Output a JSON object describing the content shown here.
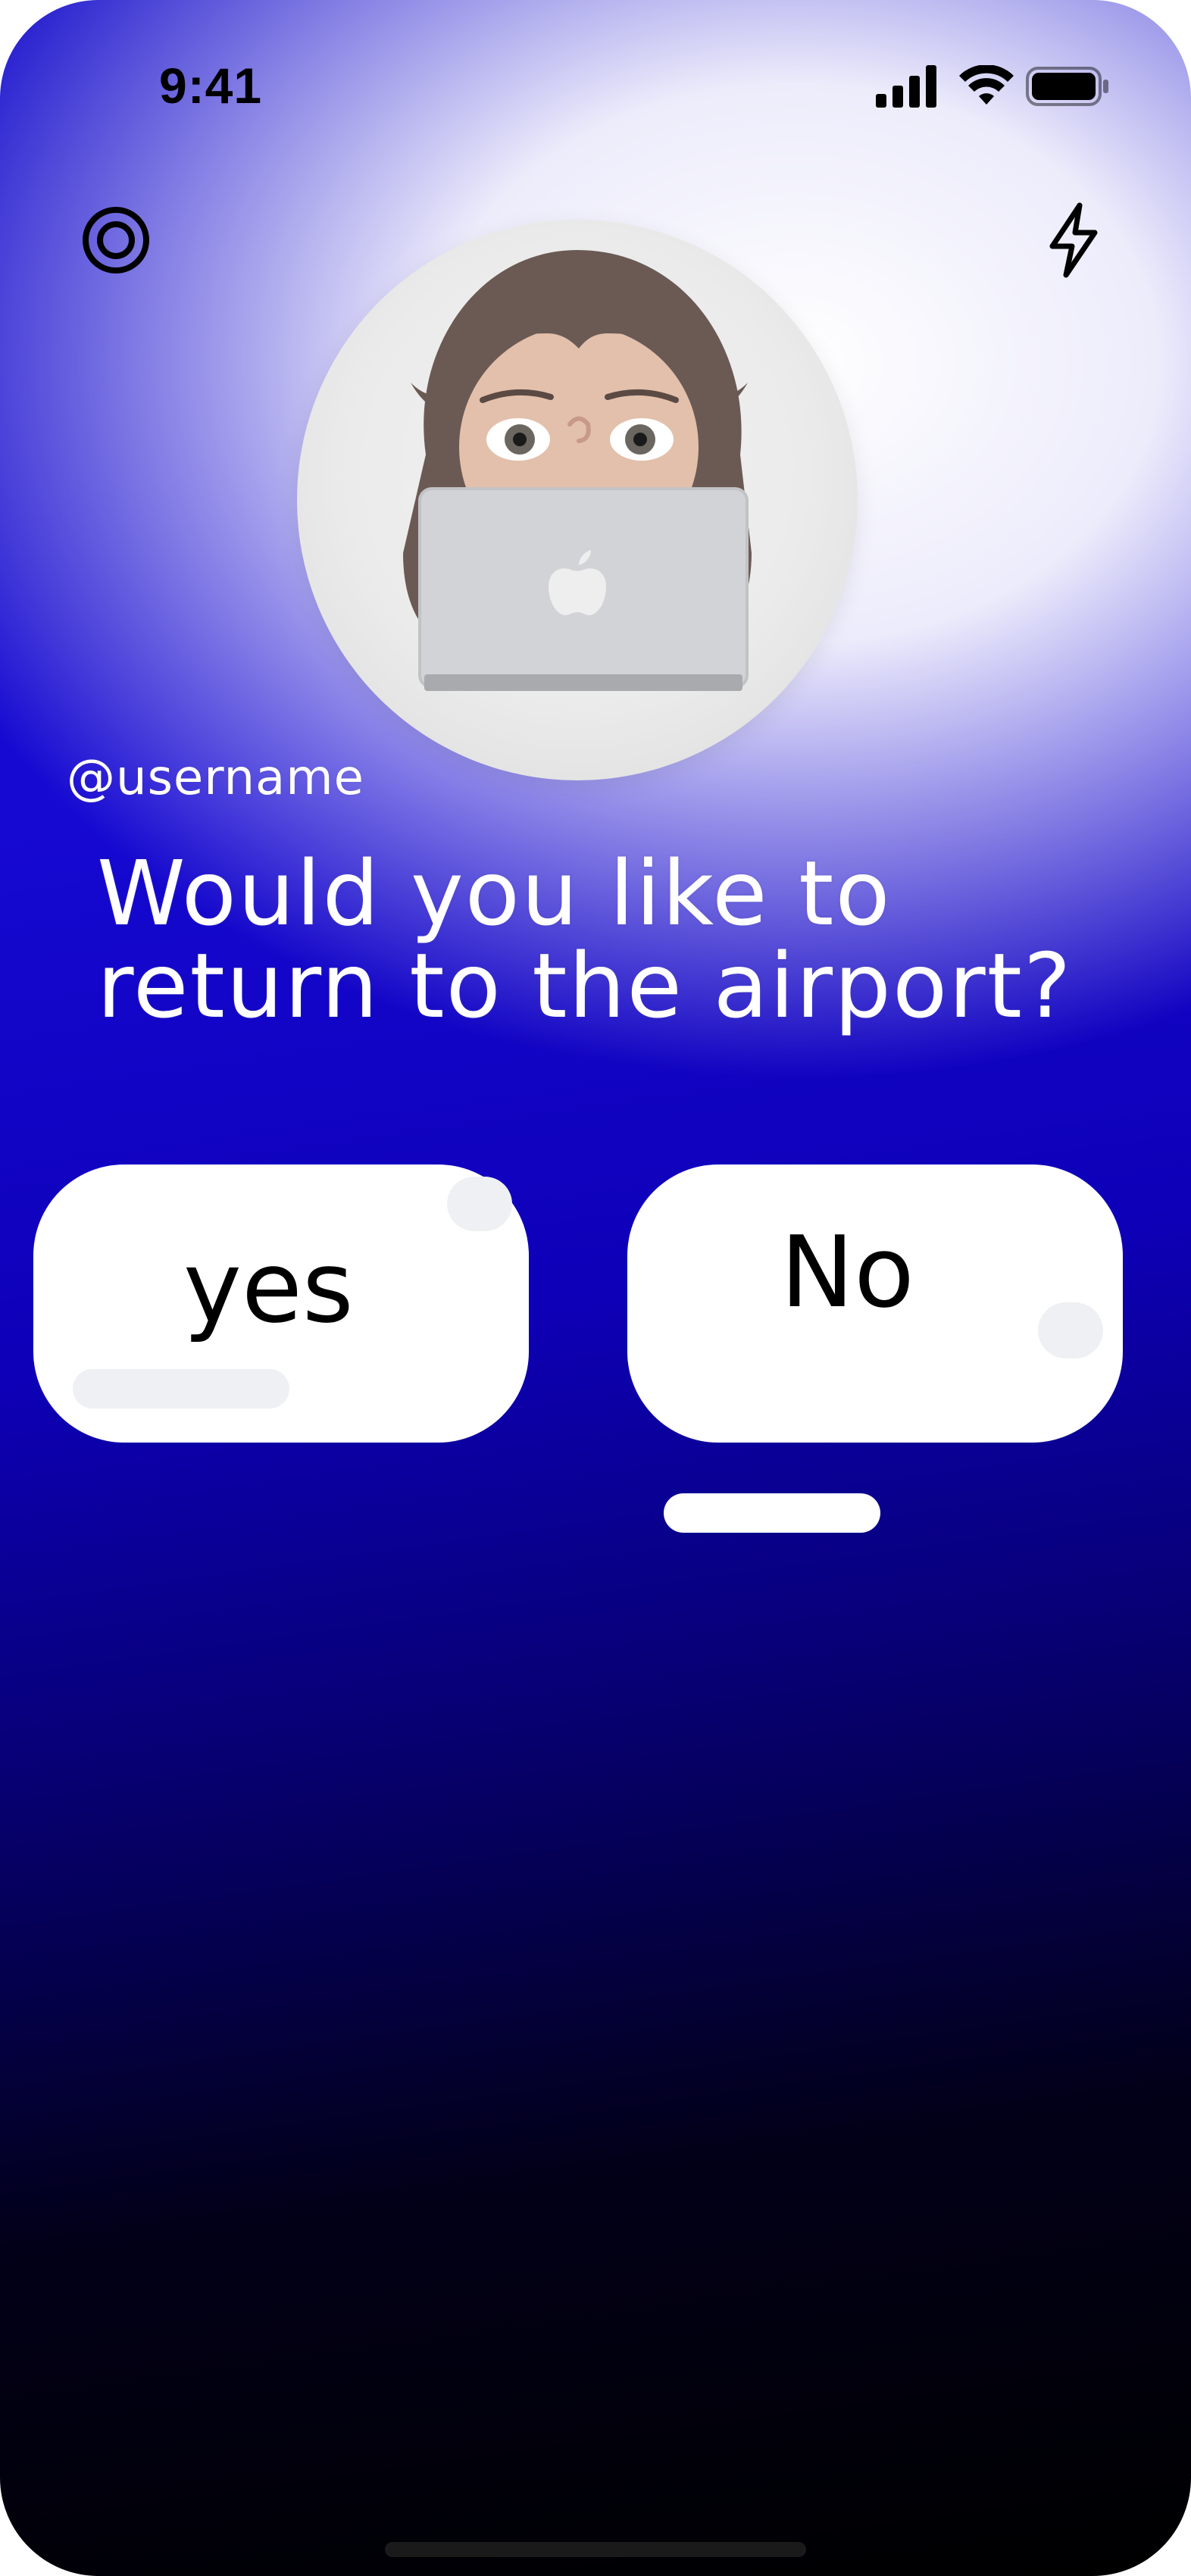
{
  "status_bar": {
    "time": "9:41",
    "icons": [
      "signal-icon",
      "wifi-icon",
      "battery-icon"
    ]
  },
  "header": {
    "left_icon": "target-icon",
    "right_icon": "lightning-icon"
  },
  "profile": {
    "username": "@username",
    "avatar": "memoji-laptop-avatar"
  },
  "prompt": {
    "question_line1": "Would you like to",
    "question_line2": "return to the airport?"
  },
  "answers": {
    "yes_label": "yes",
    "no_label": "No"
  },
  "colors": {
    "gradient_top": "#ffffff",
    "gradient_mid": "#1609d2",
    "gradient_bottom": "#000000",
    "button_bg": "#ffffff",
    "accent_deco": "#eef0f3"
  }
}
